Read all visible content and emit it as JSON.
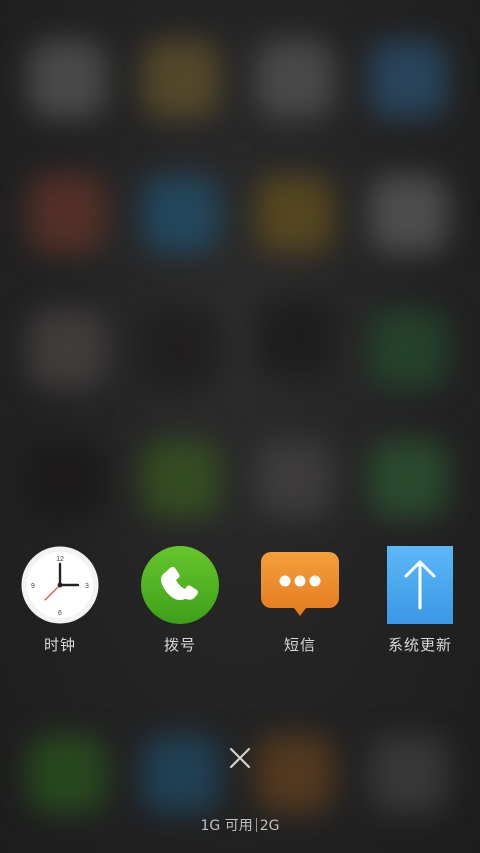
{
  "recent_apps": [
    {
      "label": "时钟",
      "icon": "clock-icon"
    },
    {
      "label": "拨号",
      "icon": "phone-icon"
    },
    {
      "label": "短信",
      "icon": "message-icon"
    },
    {
      "label": "系统更新",
      "icon": "system-update-icon"
    }
  ],
  "clock": {
    "n12": "12",
    "n3": "3",
    "n6": "6",
    "n9": "9"
  },
  "close": {
    "icon": "close-icon"
  },
  "memory": {
    "available": "1G 可用",
    "total": "2G"
  },
  "colors": {
    "background": "#222222",
    "phone_green": "#4caf1e",
    "message_orange": "#ec8a2a",
    "update_blue": "#4aa8f0",
    "label_text": "#d8d8d8"
  }
}
